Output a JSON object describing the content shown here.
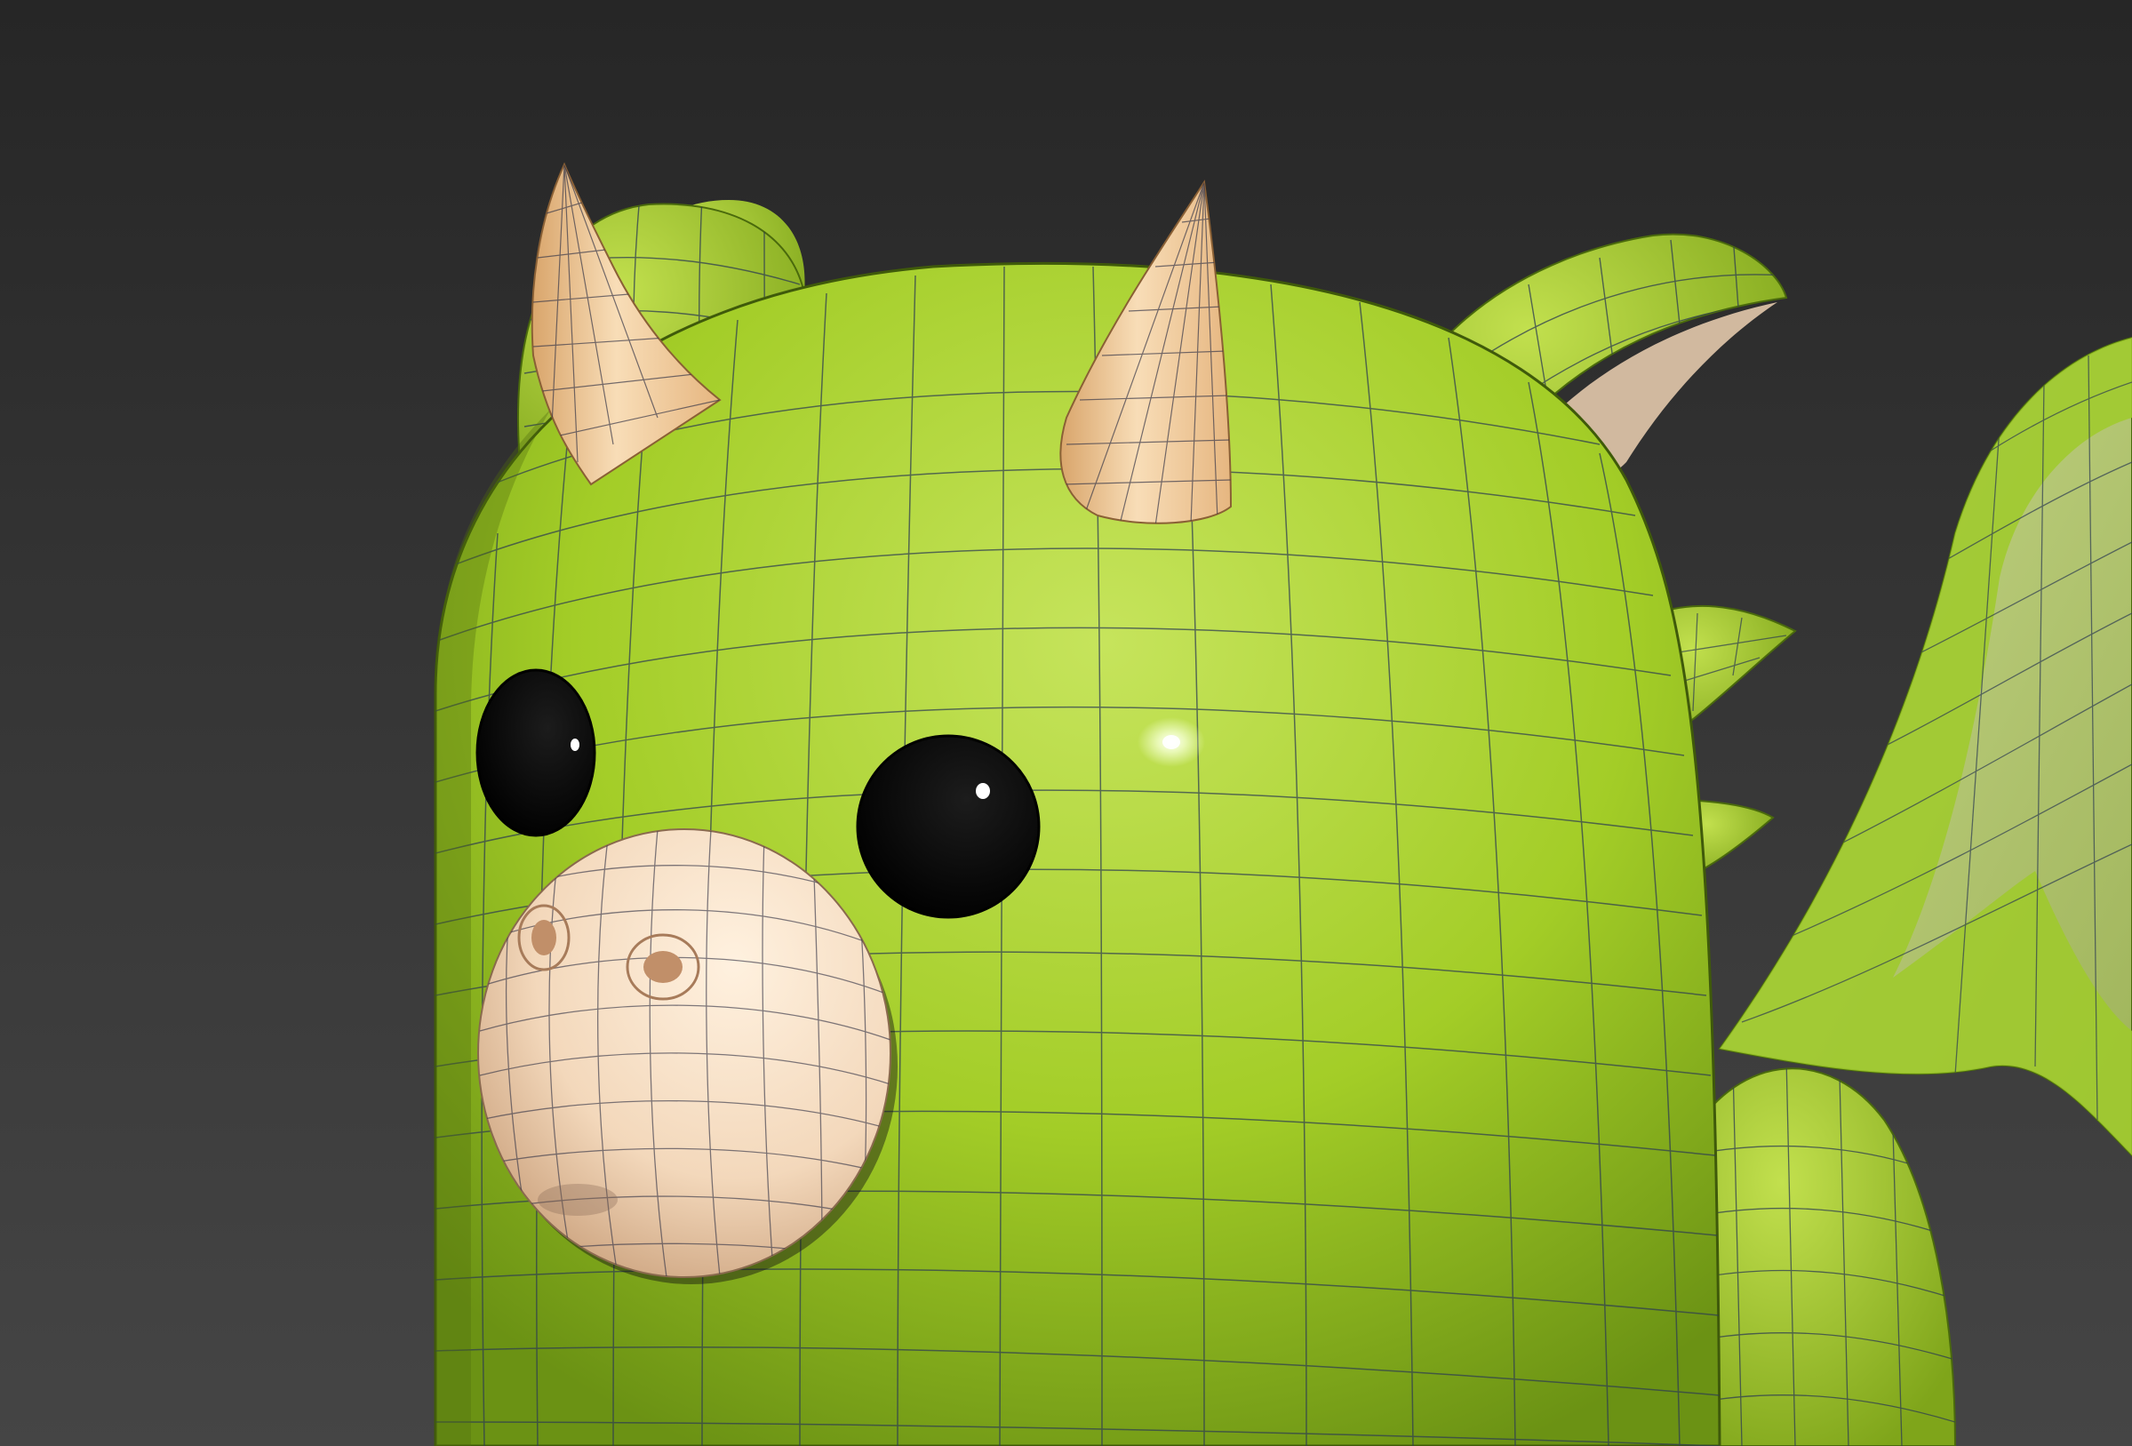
{
  "viewport": {
    "background_top": "#262626",
    "background_bottom": "#454545"
  },
  "model": {
    "subject": "dragon",
    "display_mode": "smooth-shaded-with-wireframe",
    "colors": {
      "body": "#9dc922",
      "body_light": "#c3e25a",
      "body_dark": "#5f8412",
      "horn": "#efc99a",
      "horn_dark": "#c99760",
      "snout": "#f6dec2",
      "snout_dark": "#d9b08b",
      "eye": "#060606",
      "wire": "#2e3d52",
      "wing_membrane": "#b7c97a"
    }
  }
}
